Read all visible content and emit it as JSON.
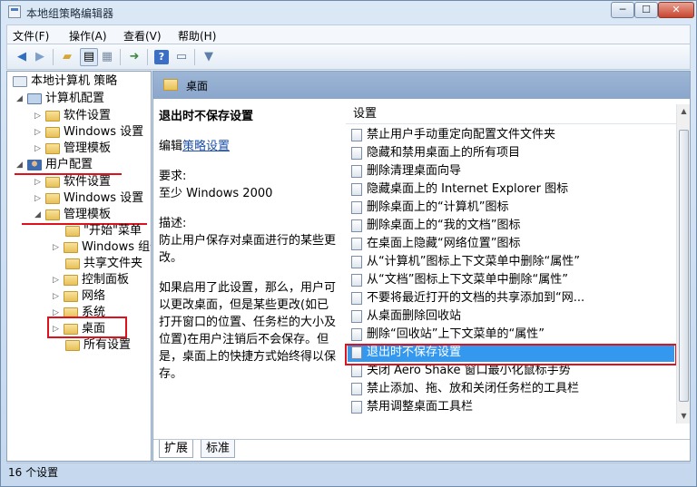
{
  "window": {
    "title": "本地组策略编辑器"
  },
  "menubar": {
    "file": "文件(F)",
    "action": "操作(A)",
    "view": "查看(V)",
    "help": "帮助(H)"
  },
  "tree": {
    "root": "本地计算机 策略",
    "computer_config": "计算机配置",
    "cc_software": "软件设置",
    "cc_windows": "Windows 设置",
    "cc_admin": "管理模板",
    "user_config": "用户配置",
    "uc_software": "软件设置",
    "uc_windows": "Windows 设置",
    "uc_admin": "管理模板",
    "start_menu": "\"开始\"菜单",
    "windows_components": "Windows 组件",
    "shared_folders": "共享文件夹",
    "control_panel": "控制面板",
    "network": "网络",
    "system": "系统",
    "desktop": "桌面",
    "all_settings": "所有设置"
  },
  "pane": {
    "header": "桌面"
  },
  "description": {
    "title": "退出时不保存设置",
    "edit_prefix": "编辑",
    "edit_link": "策略设置",
    "req_label": "要求:",
    "req_value": "至少 Windows 2000",
    "desc_label": "描述:",
    "desc_p1": "防止用户保存对桌面进行的某些更改。",
    "desc_p2": "如果启用了此设置，那么，用户可以更改桌面，但是某些更改(如已打开窗口的位置、任务栏的大小及位置)在用户注销后不会保存。但是，桌面上的快捷方式始终得以保存。"
  },
  "list": {
    "header": "设置",
    "items": [
      "禁止用户手动重定向配置文件文件夹",
      "隐藏和禁用桌面上的所有项目",
      "删除清理桌面向导",
      "隐藏桌面上的 Internet Explorer 图标",
      "删除桌面上的“计算机”图标",
      "删除桌面上的“我的文档”图标",
      "在桌面上隐藏“网络位置”图标",
      "从“计算机”图标上下文菜单中删除“属性”",
      "从“文档”图标上下文菜单中删除“属性”",
      "不要将最近打开的文档的共享添加到“网...",
      "从桌面删除回收站",
      "删除“回收站”上下文菜单的“属性”",
      "退出时不保存设置",
      "关闭 Aero Shake 窗口最小化鼠标手势",
      "禁止添加、拖、放和关闭任务栏的工具栏",
      "禁用调整桌面工具栏"
    ]
  },
  "tabs": {
    "extended": "扩展",
    "standard": "标准"
  },
  "status": {
    "text": "16 个设置"
  },
  "colors": {
    "highlight": "#e0101c",
    "selection": "#3398ee"
  }
}
